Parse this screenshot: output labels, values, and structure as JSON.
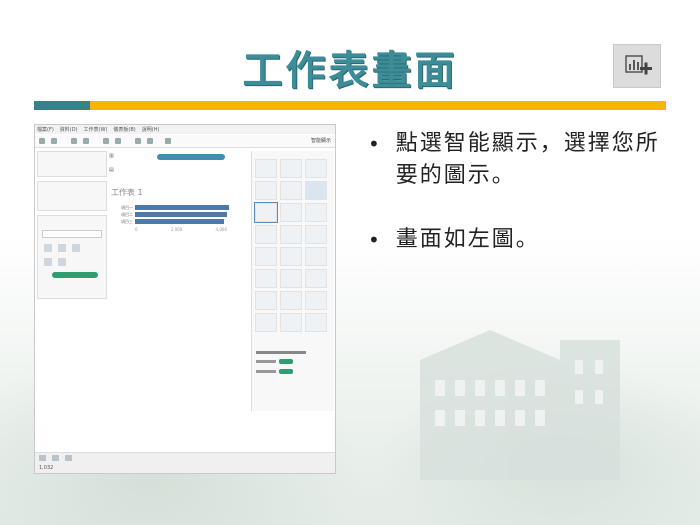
{
  "slide": {
    "title": "工作表畫面",
    "bullets": [
      "點選智能顯示，選擇您所要的圖示。",
      "畫面如左圖。"
    ]
  },
  "colors": {
    "title": "#3d8d99",
    "band_left": "#3a7f8c",
    "band_right": "#f2b705",
    "bar": "#4c79a8"
  },
  "tableau": {
    "menu": [
      "檔案(F)",
      "資料(D)",
      "工作表(W)",
      "儀表板(B)",
      "說明(H)"
    ],
    "smart_button": "智能顯示",
    "sheet_title": "工作表 1",
    "bar_labels": [
      "項目一",
      "項目二",
      "項目三"
    ],
    "bars": [
      0.9,
      0.88,
      0.86
    ],
    "axis": [
      "0",
      "2,000",
      "4,000"
    ],
    "status": "1,032"
  }
}
